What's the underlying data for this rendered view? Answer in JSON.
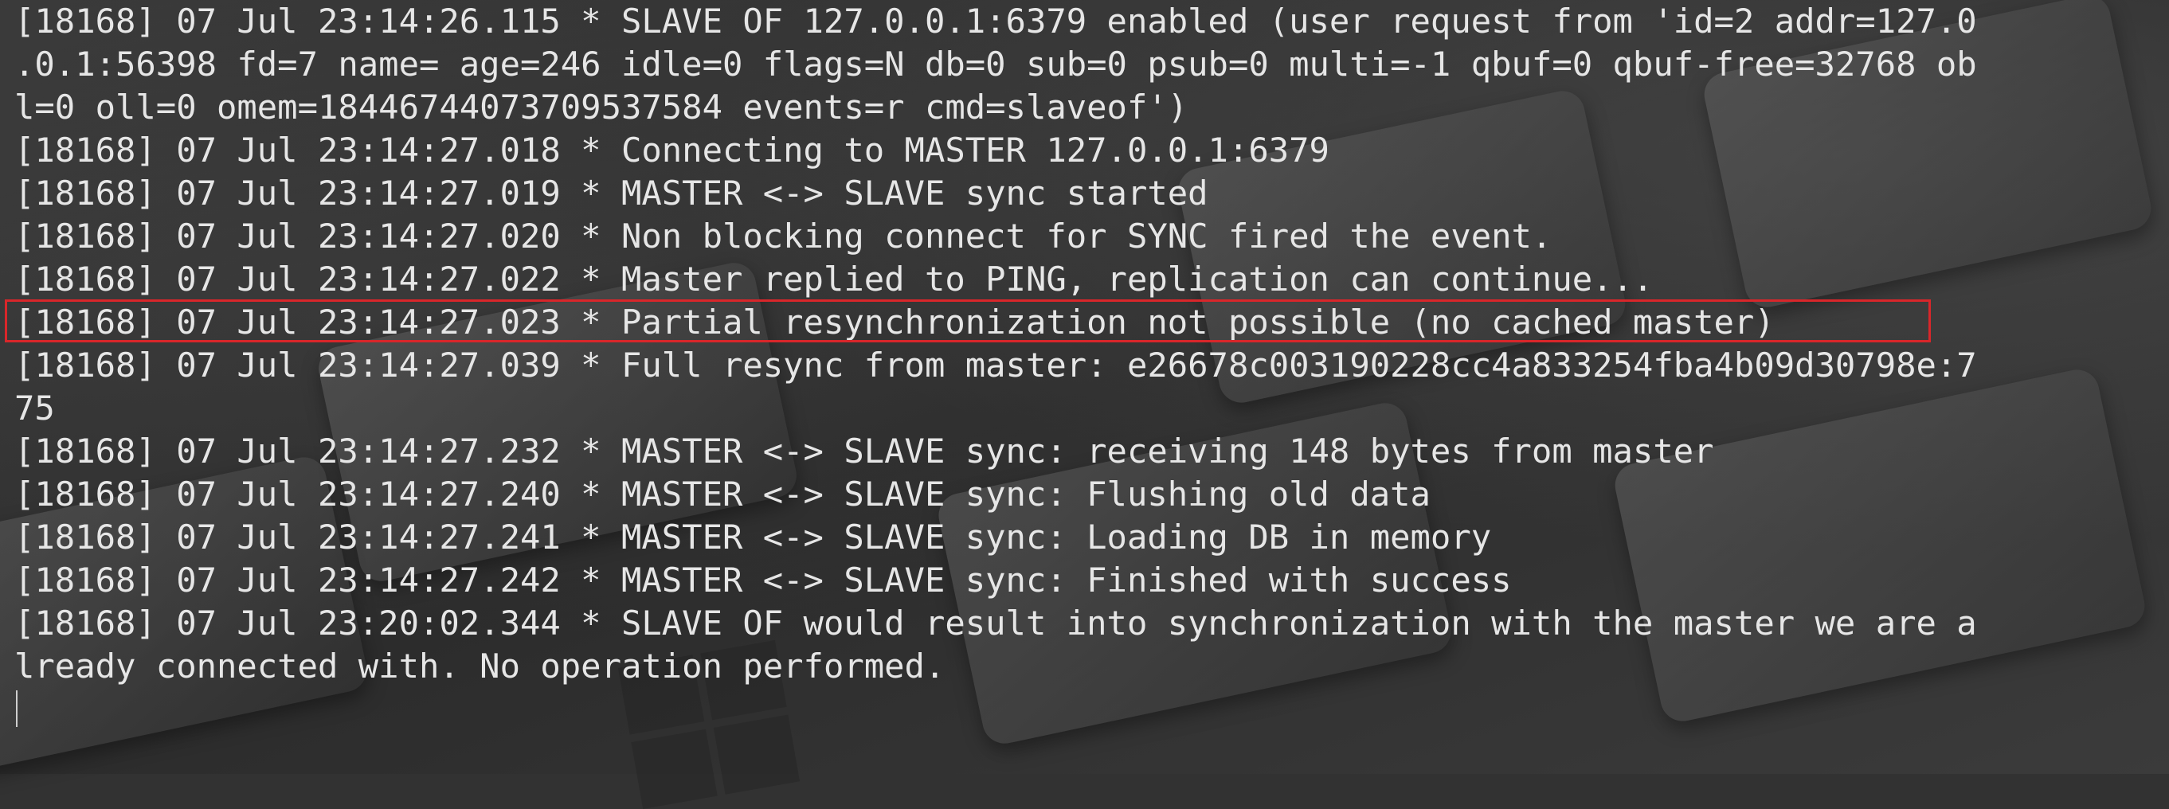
{
  "terminal": {
    "lines": [
      "[18168] 07 Jul 23:14:26.115 * SLAVE OF 127.0.0.1:6379 enabled (user request from 'id=2 addr=127.0",
      ".0.1:56398 fd=7 name= age=246 idle=0 flags=N db=0 sub=0 psub=0 multi=-1 qbuf=0 qbuf-free=32768 ob",
      "l=0 oll=0 omem=18446744073709537584 events=r cmd=slaveof')",
      "[18168] 07 Jul 23:14:27.018 * Connecting to MASTER 127.0.0.1:6379",
      "[18168] 07 Jul 23:14:27.019 * MASTER <-> SLAVE sync started",
      "[18168] 07 Jul 23:14:27.020 * Non blocking connect for SYNC fired the event.",
      "[18168] 07 Jul 23:14:27.022 * Master replied to PING, replication can continue...",
      "[18168] 07 Jul 23:14:27.023 * Partial resynchronization not possible (no cached master)",
      "[18168] 07 Jul 23:14:27.039 * Full resync from master: e26678c003190228cc4a833254fba4b09d30798e:7",
      "75",
      "[18168] 07 Jul 23:14:27.232 * MASTER <-> SLAVE sync: receiving 148 bytes from master",
      "[18168] 07 Jul 23:14:27.240 * MASTER <-> SLAVE sync: Flushing old data",
      "[18168] 07 Jul 23:14:27.241 * MASTER <-> SLAVE sync: Loading DB in memory",
      "[18168] 07 Jul 23:14:27.242 * MASTER <-> SLAVE sync: Finished with success",
      "[18168] 07 Jul 23:20:02.344 * SLAVE OF would result into synchronization with the master we are a",
      "lready connected with. No operation performed."
    ],
    "highlighted_line_index": 7
  },
  "colors": {
    "text": "#e6e6e6",
    "background": "#323232",
    "highlight_border": "#d9262a"
  }
}
